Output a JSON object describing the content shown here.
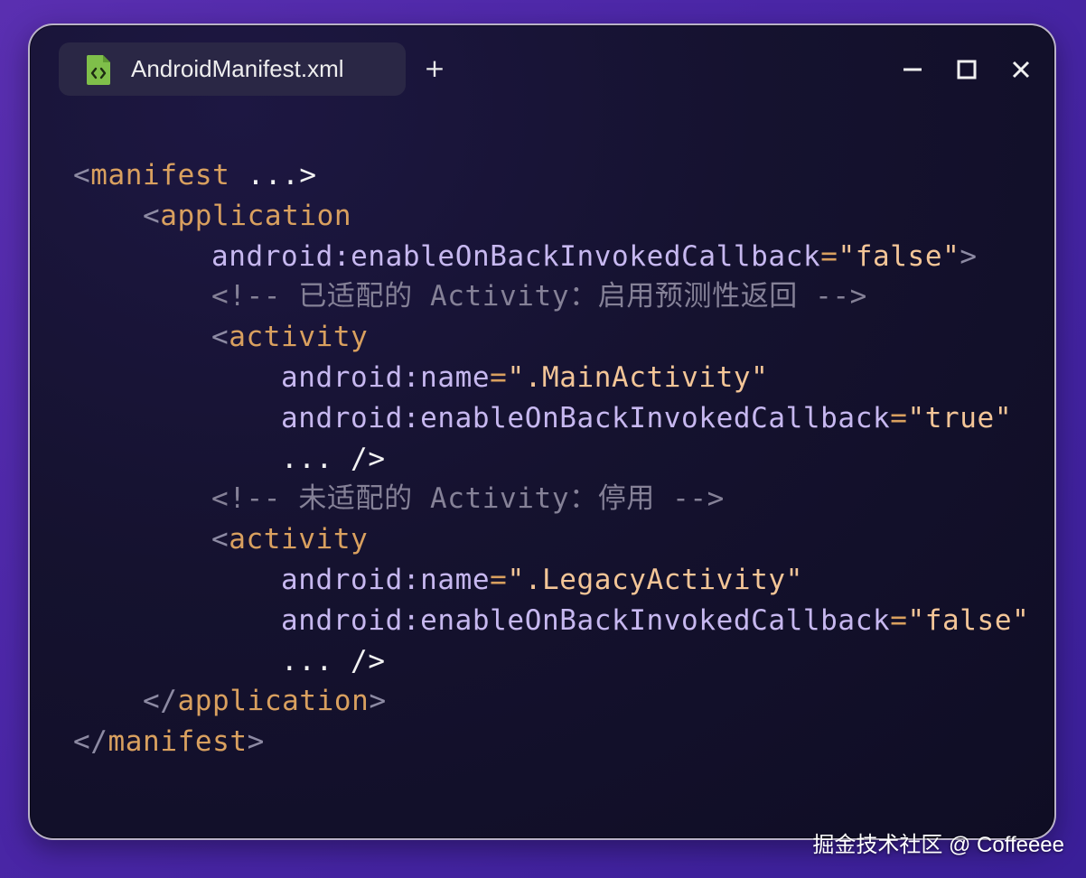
{
  "tab": {
    "icon": "xml-file-icon",
    "title": "AndroidManifest.xml"
  },
  "add_tab_label": "+",
  "window_controls": {
    "minimize_icon": "minimize-icon",
    "maximize_icon": "maximize-icon",
    "close_icon": "close-icon"
  },
  "code": {
    "l1": {
      "open": "<",
      "tag": "manifest",
      "rest": " ...>"
    },
    "l2": {
      "open": "<",
      "tag": "application"
    },
    "l3": {
      "attr": "android:enableOnBackInvokedCallback",
      "eq": "=",
      "val": "\"false\"",
      "close": ">"
    },
    "l4": {
      "comment": "<!-- 已适配的 Activity：启用预测性返回 -->"
    },
    "l5": {
      "open": "<",
      "tag": "activity"
    },
    "l6": {
      "attr": "android:name",
      "eq": "=",
      "val": "\".MainActivity\""
    },
    "l7": {
      "attr": "android:enableOnBackInvokedCallback",
      "eq": "=",
      "val": "\"true\""
    },
    "l8": {
      "text": "... />"
    },
    "l9": {
      "comment": "<!-- 未适配的 Activity：停用 -->"
    },
    "l10": {
      "open": "<",
      "tag": "activity"
    },
    "l11": {
      "attr": "android:name",
      "eq": "=",
      "val": "\".LegacyActivity\""
    },
    "l12": {
      "attr": "android:enableOnBackInvokedCallback",
      "eq": "=",
      "val": "\"false\""
    },
    "l13": {
      "text": "... />"
    },
    "l14": {
      "open": "</",
      "tag": "application",
      "close": ">"
    },
    "l15": {
      "open": "</",
      "tag": "manifest",
      "close": ">"
    }
  },
  "watermark": "掘金技术社区 @ Coffeeee",
  "colors": {
    "background": "#4a26a6",
    "window": "#15122f",
    "tag": "#d9a05f",
    "attribute": "#c7b8f0",
    "string": "#f3c597",
    "comment": "#858197",
    "file_icon": "#7fbf4a"
  }
}
